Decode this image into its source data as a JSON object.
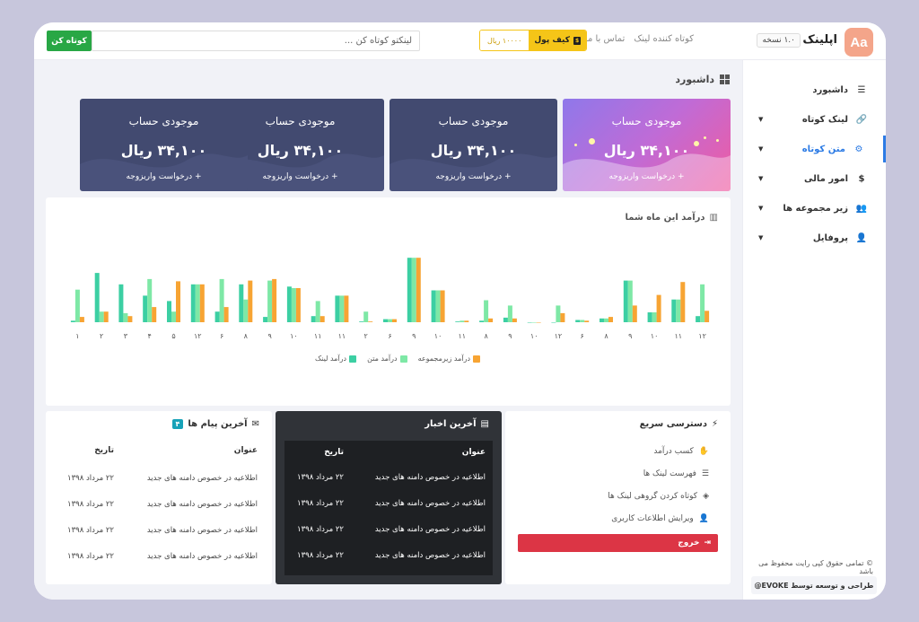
{
  "header": {
    "logo_text": "Aa",
    "brand": "اپلینک",
    "version": "۱.۰ نسخه",
    "nav": [
      "کوتاه کننده لینک",
      "تماس با ما"
    ],
    "wallet_label": "کیف پول",
    "wallet_cash_icon_text": "$",
    "wallet_value": "۱۰۰۰۰ ریال",
    "search_placeholder": "لینکتو کوتاه کن ...",
    "shorten_button": "کوتاه کن"
  },
  "sidebar": {
    "items": [
      {
        "label": "داشبورد",
        "icon": "list-icon",
        "glyph": "☰",
        "chevron": false,
        "active": false
      },
      {
        "label": "لینک کوتاه",
        "icon": "link-icon",
        "glyph": "🔗",
        "chevron": true,
        "active": false
      },
      {
        "label": "متن کوتاه",
        "icon": "text-icon",
        "glyph": "⚙",
        "chevron": true,
        "active": true
      },
      {
        "label": "امور مالی",
        "icon": "money-icon",
        "glyph": "$",
        "chevron": true,
        "active": false
      },
      {
        "label": "زیر مجموعه ها",
        "icon": "users-icon",
        "glyph": "👥",
        "chevron": true,
        "active": false
      },
      {
        "label": "پروفایل",
        "icon": "user-icon",
        "glyph": "👤",
        "chevron": true,
        "active": false
      }
    ],
    "copyright": "© تمامی حقوق کپی رایت محفوظ می باشد",
    "credit": "طراحی و توسعه توسط EVOKE@"
  },
  "main": {
    "page_title": "داشبورد",
    "cards": [
      {
        "title": "موجودی حساب",
        "value": "۳۴,۱۰۰ ریال",
        "link": "+ درخواست واریزوجه"
      },
      {
        "title": "موجودی حساب",
        "value": "۳۴,۱۰۰ ریال",
        "link": "+ درخواست واریزوجه"
      },
      {
        "title": "موجودی حساب",
        "value": "۳۴,۱۰۰ ریال",
        "link": "+ درخواست واریزوجه"
      },
      {
        "title": "موجودی حساب",
        "value": "۳۴,۱۰۰ ریال",
        "link": "+ درخواست واریزوجه"
      }
    ],
    "chart_title": "درآمد این ماه شما",
    "quick": {
      "title": "دسترسی سریع",
      "items": [
        {
          "label": "کسب درآمد",
          "icon": "hand-coin-icon",
          "glyph": "✋"
        },
        {
          "label": "فهرست لینک ها",
          "icon": "list-icon",
          "glyph": "☰"
        },
        {
          "label": "کوتاه کردن گروهی لینک ها",
          "icon": "layers-icon",
          "glyph": "◈"
        },
        {
          "label": "ویرایش اطلاعات کاربری",
          "icon": "user-edit-icon",
          "glyph": "👤"
        }
      ],
      "logout": "خروج"
    },
    "news": {
      "title": "آخرین اخبار",
      "col_title": "عنوان",
      "col_date": "تاریخ",
      "rows": [
        {
          "title": "اطلاعیه در خصوص دامنه های جدید",
          "date": "۲۲ مرداد ۱۳۹۸"
        },
        {
          "title": "اطلاعیه در خصوص دامنه های جدید",
          "date": "۲۲ مرداد ۱۳۹۸"
        },
        {
          "title": "اطلاعیه در خصوص دامنه های جدید",
          "date": "۲۲ مرداد ۱۳۹۸"
        },
        {
          "title": "اطلاعیه در خصوص دامنه های جدید",
          "date": "۲۲ مرداد ۱۳۹۸"
        }
      ]
    },
    "messages": {
      "title": "آخرین پیام ها",
      "badge": "۴",
      "col_title": "عنوان",
      "col_date": "تاریخ",
      "rows": [
        {
          "title": "اطلاعیه در خصوص دامنه های جدید",
          "date": "۲۲ مرداد ۱۳۹۸"
        },
        {
          "title": "اطلاعیه در خصوص دامنه های جدید",
          "date": "۲۲ مرداد ۱۳۹۸"
        },
        {
          "title": "اطلاعیه در خصوص دامنه های جدید",
          "date": "۲۲ مرداد ۱۳۹۸"
        },
        {
          "title": "اطلاعیه در خصوص دامنه های جدید",
          "date": "۲۲ مرداد ۱۳۹۸"
        }
      ]
    }
  },
  "colors": {
    "link": "#3ccfa3",
    "text": "#7ee8a6",
    "sub": "#f7a433",
    "active": "#2c7be5"
  },
  "chart_data": {
    "type": "bar",
    "title": "درآمد این ماه شما",
    "categories": [
      "۱",
      "۲",
      "۳",
      "۴",
      "۵",
      "۱۲",
      "۶",
      "۸",
      "۹",
      "۱۰",
      "۱۱",
      "۱۱",
      "۲",
      "۶",
      "۹",
      "۱۰",
      "۱۱",
      "۸",
      "۹",
      "۱۰",
      "۱۲",
      "۶",
      "۸",
      "۹",
      "۱۰",
      "۱۱",
      "۱۲"
    ],
    "series": [
      {
        "name": "درآمد لینک",
        "color": "#3ccfa3",
        "values": [
          2,
          65,
          50,
          35,
          28,
          50,
          14,
          50,
          7,
          47,
          8,
          35,
          1,
          4,
          85,
          42,
          1,
          2,
          6,
          0,
          0,
          3,
          5,
          55,
          13,
          30,
          8
        ]
      },
      {
        "name": "درآمد متن",
        "color": "#7ee8a6",
        "values": [
          43,
          14,
          12,
          57,
          14,
          50,
          57,
          30,
          55,
          45,
          28,
          35,
          14,
          4,
          85,
          42,
          2,
          29,
          22,
          0,
          22,
          3,
          5,
          55,
          13,
          30,
          50
        ]
      },
      {
        "name": "درآمد زیرمجموعه",
        "color": "#f7a433",
        "values": [
          7,
          14,
          8,
          20,
          54,
          50,
          20,
          55,
          57,
          45,
          8,
          35,
          1,
          4,
          85,
          42,
          2,
          5,
          5,
          0,
          12,
          2,
          7,
          22,
          36,
          53,
          15
        ]
      }
    ],
    "ylim": [
      0,
      90
    ],
    "legend_position": "bottom"
  }
}
